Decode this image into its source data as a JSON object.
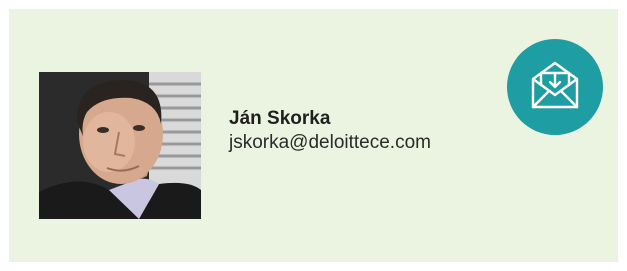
{
  "contact": {
    "name": "Ján Skorka",
    "email": "jskorka@deloittece.com",
    "photo_alt": "Ján Skorka"
  },
  "icons": {
    "mail_button": "envelope-download-icon"
  },
  "colors": {
    "card_background": "#ebf4e0",
    "accent": "#1e9ea3",
    "name_text": "#1f1f1f",
    "email_text": "#2b2b2b"
  }
}
